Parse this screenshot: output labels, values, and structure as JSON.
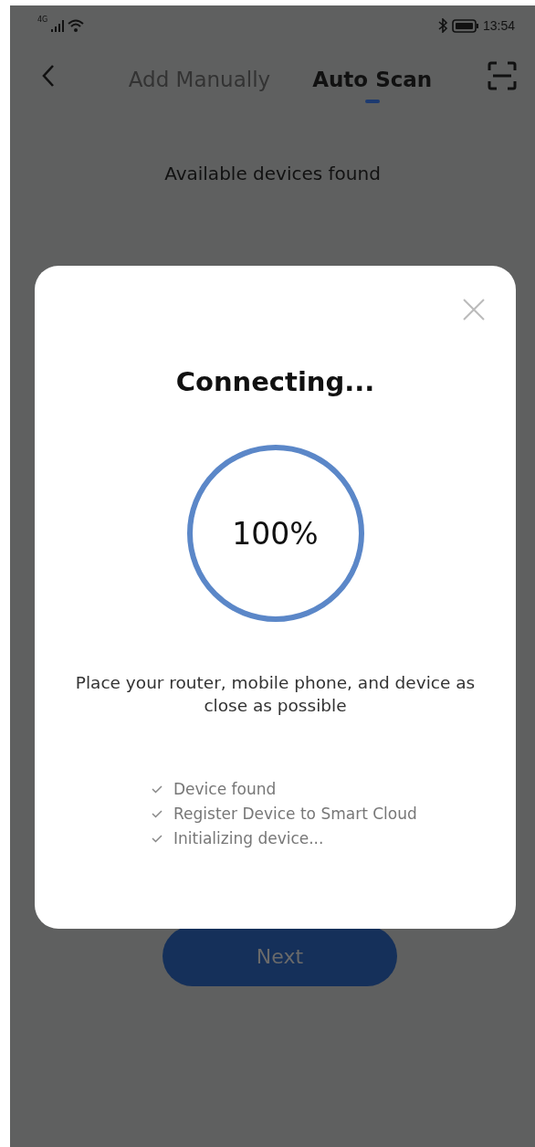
{
  "status_bar": {
    "network": "4G",
    "time": "13:54"
  },
  "tabs": [
    {
      "label": "Add Manually",
      "selected": false
    },
    {
      "label": "Auto Scan",
      "selected": true
    }
  ],
  "heading": "Available devices found",
  "next_button": {
    "label": "Next",
    "disabled": true
  },
  "dialog": {
    "title": "Connecting...",
    "progress": {
      "level": 1,
      "reading": "100%"
    },
    "hint": "Place your router, mobile phone, and device as close as possible",
    "steps": [
      {
        "label": "Device found",
        "done": true
      },
      {
        "label": "Register Device to Smart Cloud",
        "done": true
      },
      {
        "label": "Initializing device...",
        "done": true
      }
    ]
  }
}
